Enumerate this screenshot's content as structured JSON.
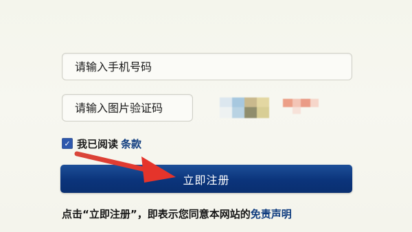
{
  "form": {
    "phone_placeholder": "请输入手机号码",
    "captcha_placeholder": "请输入图片验证码",
    "agree_text": "我已阅读",
    "terms_link": "条款",
    "checkbox_checked": true,
    "register_label": "立即注册",
    "notice_prefix": "点击“立即注册”，即表示您同意本网站的",
    "disclaimer_link": "免责声明"
  },
  "colors": {
    "accent": "#0f3c7f",
    "button": "#0b347b",
    "arrow": "#e23a31",
    "background": "#f6f6ee"
  },
  "icons": {
    "captcha": "captcha-image",
    "checkbox": "check-icon",
    "arrow": "red-arrow-annotation"
  }
}
